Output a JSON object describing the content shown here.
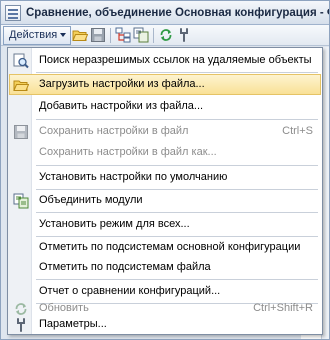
{
  "window": {
    "title": "Сравнение, объединение Основная конфигурация - Файл"
  },
  "toolbar": {
    "actions_label": "Действия"
  },
  "menu": {
    "items": [
      {
        "label": "Поиск неразрешимых ссылок на удаляемые объекты",
        "shortcut": "",
        "icon": "search-refs-icon"
      },
      {
        "label": "Загрузить настройки из файла...",
        "shortcut": "",
        "icon": "folder-open-icon"
      },
      {
        "label": "Добавить настройки из файла...",
        "shortcut": "",
        "icon": ""
      },
      {
        "label": "Сохранить настройки в файл",
        "shortcut": "Ctrl+S",
        "icon": "save-disk-icon"
      },
      {
        "label": "Сохранить настройки в файл как...",
        "shortcut": "",
        "icon": ""
      },
      {
        "label": "Установить настройки по умолчанию",
        "shortcut": "",
        "icon": ""
      },
      {
        "label": "Объединить модули",
        "shortcut": "",
        "icon": "merge-modules-icon"
      },
      {
        "label": "Установить режим для всех...",
        "shortcut": "",
        "icon": ""
      },
      {
        "label": "Отметить по подсистемам основной конфигурации",
        "shortcut": "",
        "icon": ""
      },
      {
        "label": "Отметить по подсистемам файла",
        "shortcut": "",
        "icon": ""
      },
      {
        "label": "Отчет о сравнении конфигураций...",
        "shortcut": "",
        "icon": ""
      },
      {
        "label": "Обновить",
        "shortcut": "Ctrl+Shift+R",
        "icon": "refresh-icon"
      },
      {
        "label": "Параметры...",
        "shortcut": "",
        "icon": "wrench-icon"
      }
    ]
  },
  "colors": {
    "highlight": "#f9e196",
    "highlight_border": "#e5c365",
    "disabled_text": "#8c8c8c",
    "accent": "#1a2f58"
  }
}
